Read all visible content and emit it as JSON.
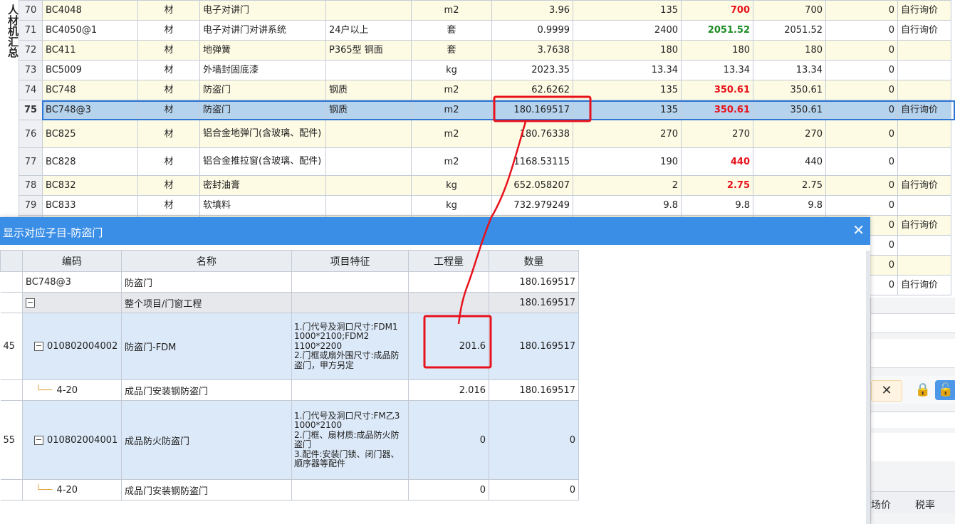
{
  "side_label": "人材机汇总",
  "rows": [
    {
      "idx": "70",
      "code": "BC4048",
      "type": "材",
      "name": "电子对讲门",
      "spec": "",
      "unit": "m2",
      "qty": "3.96",
      "p1": "135",
      "p2": "700",
      "p2_style": "red",
      "p3": "700",
      "p4": "0",
      "note": "自行询价"
    },
    {
      "idx": "71",
      "code": "BC4050@1",
      "type": "材",
      "name": "电子对讲门对讲系统",
      "spec": "24户以上",
      "unit": "套",
      "qty": "0.9999",
      "p1": "2400",
      "p2": "2051.52",
      "p2_style": "green",
      "p3": "2051.52",
      "p4": "0",
      "note": "自行询价"
    },
    {
      "idx": "72",
      "code": "BC411",
      "type": "材",
      "name": "地弹簧",
      "spec": "P365型 铜面",
      "unit": "套",
      "qty": "3.7638",
      "p1": "180",
      "p2": "180",
      "p2_style": "",
      "p3": "180",
      "p4": "0",
      "note": ""
    },
    {
      "idx": "73",
      "code": "BC5009",
      "type": "材",
      "name": "外墙封固底漆",
      "spec": "",
      "unit": "kg",
      "qty": "2023.35",
      "p1": "13.34",
      "p2": "13.34",
      "p2_style": "",
      "p3": "13.34",
      "p4": "0",
      "note": ""
    },
    {
      "idx": "74",
      "code": "BC748",
      "type": "材",
      "name": "防盗门",
      "spec": "钢质",
      "unit": "m2",
      "qty": "62.6262",
      "p1": "135",
      "p2": "350.61",
      "p2_style": "red",
      "p3": "350.61",
      "p4": "0",
      "note": ""
    },
    {
      "idx": "75",
      "code": "BC748@3",
      "type": "材",
      "name": "防盗门",
      "spec": "钢质",
      "unit": "m2",
      "qty": "180.169517",
      "p1": "135",
      "p2": "350.61",
      "p2_style": "red",
      "p3": "350.61",
      "p4": "0",
      "note": "自行询价"
    },
    {
      "idx": "76",
      "code": "BC825",
      "type": "材",
      "name": "铝合金地弹门(含玻璃、配件)",
      "spec": "",
      "unit": "m2",
      "qty": "180.76338",
      "p1": "270",
      "p2": "270",
      "p2_style": "",
      "p3": "270",
      "p4": "0",
      "note": ""
    },
    {
      "idx": "77",
      "code": "BC828",
      "type": "材",
      "name": "铝合金推拉窗(含玻璃、配件)",
      "spec": "",
      "unit": "m2",
      "qty": "1168.53115",
      "p1": "190",
      "p2": "440",
      "p2_style": "red",
      "p3": "440",
      "p4": "0",
      "note": ""
    },
    {
      "idx": "78",
      "code": "BC832",
      "type": "材",
      "name": "密封油膏",
      "spec": "",
      "unit": "kg",
      "qty": "652.058207",
      "p1": "2",
      "p2": "2.75",
      "p2_style": "red",
      "p3": "2.75",
      "p4": "0",
      "note": "自行询价"
    },
    {
      "idx": "79",
      "code": "BC833",
      "type": "材",
      "name": "软填料",
      "spec": "",
      "unit": "kg",
      "qty": "732.979249",
      "p1": "9.8",
      "p2": "9.8",
      "p2_style": "",
      "p3": "9.8",
      "p4": "0",
      "note": ""
    }
  ],
  "hidden_rows_right": [
    {
      "p4": "0",
      "note": "自行询价"
    },
    {
      "p4": "0",
      "note": ""
    },
    {
      "p4": "0",
      "note": ""
    },
    {
      "p4": "0",
      "note": "自行询价"
    }
  ],
  "right_pane": {
    "close_glyph": "✕",
    "lock_glyph": "🔒",
    "unlock_glyph": "🔓",
    "headers": [
      "场价",
      "税率"
    ]
  },
  "dialog": {
    "title": "显示对应子目-防盗门",
    "close_glyph": "✕",
    "headers": [
      "编码",
      "名称",
      "项目特征",
      "工程量",
      "数量"
    ],
    "rows": [
      {
        "idx": "",
        "tree": "",
        "code": "BC748@3",
        "name": "防盗门",
        "feat": "",
        "gcl": "",
        "qty": "180.169517",
        "style": "white",
        "level": 0
      },
      {
        "idx": "",
        "tree": "⊟",
        "code": "",
        "name": "整个项目/门窗工程",
        "feat": "",
        "gcl": "",
        "qty": "180.169517",
        "style": "gray",
        "level": 0
      },
      {
        "idx": "45",
        "tree": "⊟",
        "code": "010802004002",
        "name": "防盗门-FDM",
        "feat": "1.门代号及洞口尺寸:FDM1 1000*2100;FDM2 1100*2200\n2.门框或扇外围尺寸:成品防盗门，甲方另定",
        "gcl": "201.6",
        "qty": "180.169517",
        "style": "blue",
        "level": 1
      },
      {
        "idx": "",
        "tree": "",
        "code": "4-20",
        "name": "成品门安装钢防盗门",
        "feat": "",
        "gcl": "2.016",
        "qty": "180.169517",
        "style": "white",
        "level": 2
      },
      {
        "idx": "55",
        "tree": "⊟",
        "code": "010802004001",
        "name": "成品防火防盗门",
        "feat": "1.门代号及洞口尺寸:FM乙3 1000*2100\n2.门框、扇材质:成品防火防盗门\n3.配件:安装门锁、闭门器、顺序器等配件",
        "gcl": "0",
        "qty": "0",
        "style": "blue",
        "level": 1
      },
      {
        "idx": "",
        "tree": "",
        "code": "4-20",
        "name": "成品门安装钢防盗门",
        "feat": "",
        "gcl": "0",
        "qty": "0",
        "style": "white",
        "level": 2
      }
    ]
  },
  "colors": {
    "title_bar": "#3a8ee6",
    "highlight_red": "#e8121b",
    "selected_row": "#b6d3ee"
  }
}
